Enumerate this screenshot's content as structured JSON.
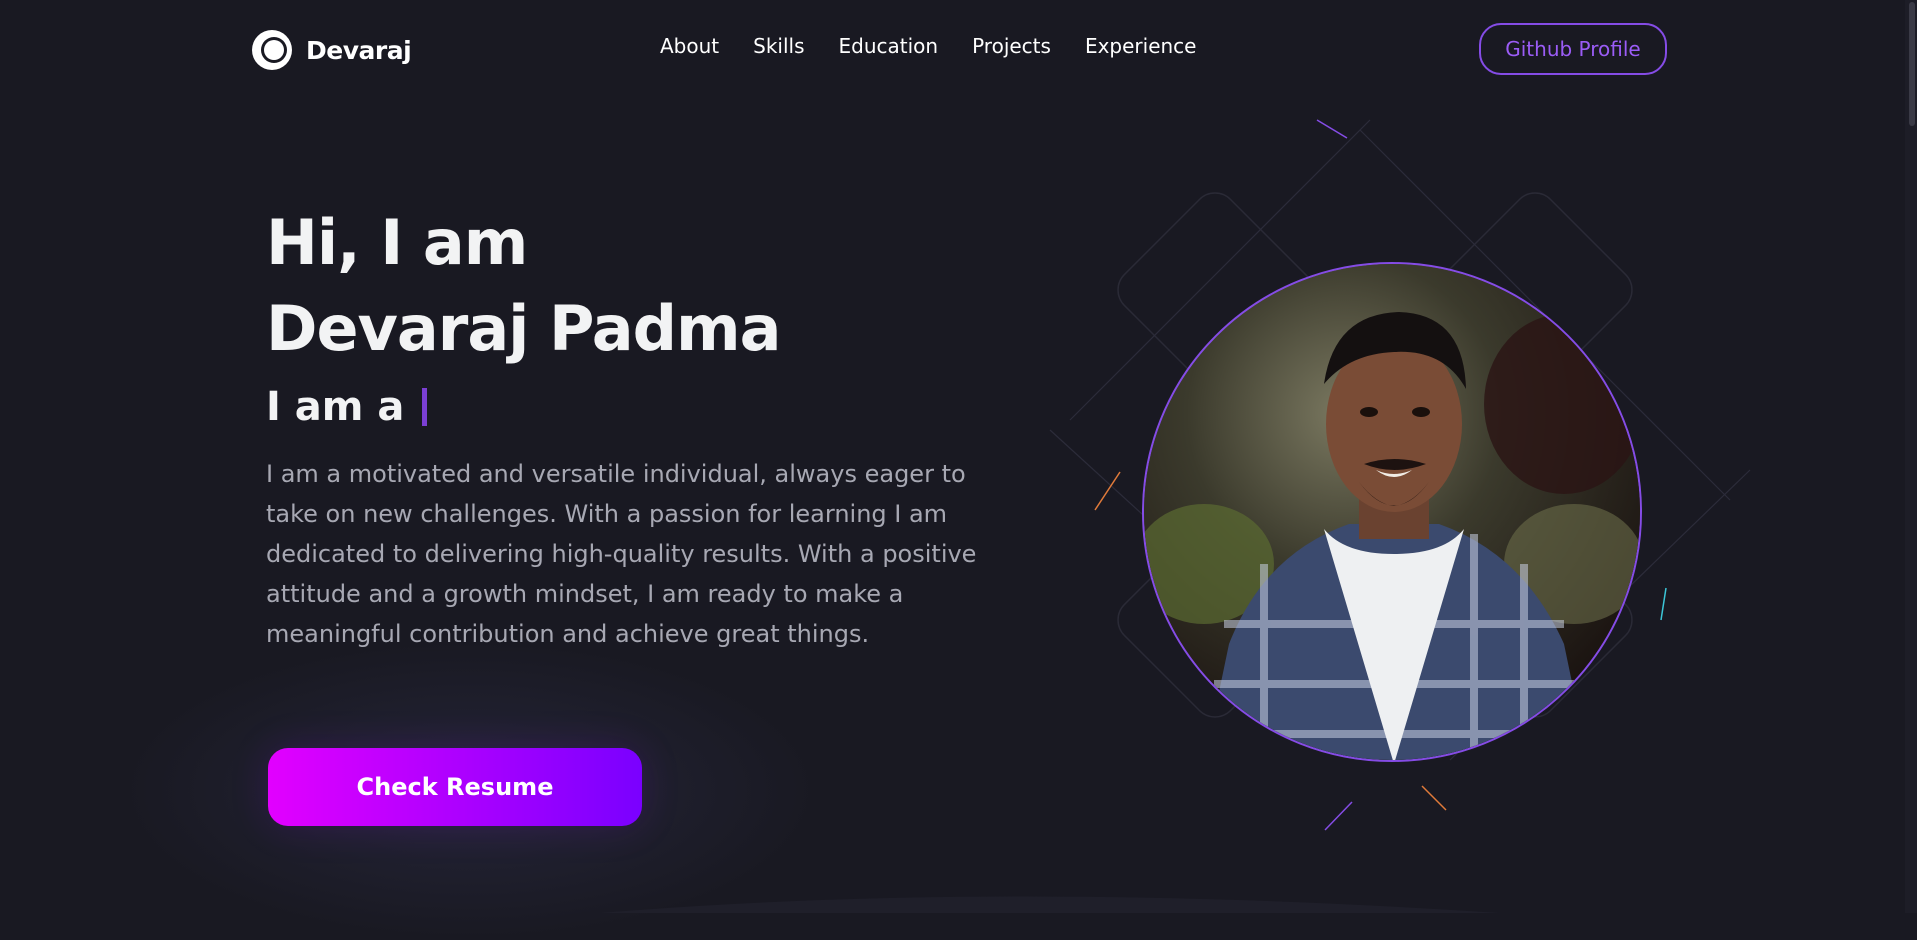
{
  "brand": {
    "name": "Devaraj",
    "icon": "logo-mark-icon"
  },
  "nav": {
    "links": [
      "About",
      "Skills",
      "Education",
      "Projects",
      "Experience"
    ],
    "github_label": "Github Profile"
  },
  "hero": {
    "title_line1": "Hi, I am",
    "title_line2": "Devaraj Padma",
    "typed_prefix": "I am a",
    "description": "I am a motivated and versatile individual, always eager to take on new challenges. With a passion for learning I am dedicated to delivering high-quality results. With a positive attitude and a growth mindset, I am ready to make a meaningful contribution and achieve great things.",
    "resume_label": "Check Resume"
  },
  "colors": {
    "background": "#191922",
    "accent": "#854ce6",
    "button_gradient_start": "#e200ff",
    "button_gradient_end": "#7a00ff",
    "text_primary": "#f2f3f4",
    "text_secondary": "#a7a8b3"
  }
}
